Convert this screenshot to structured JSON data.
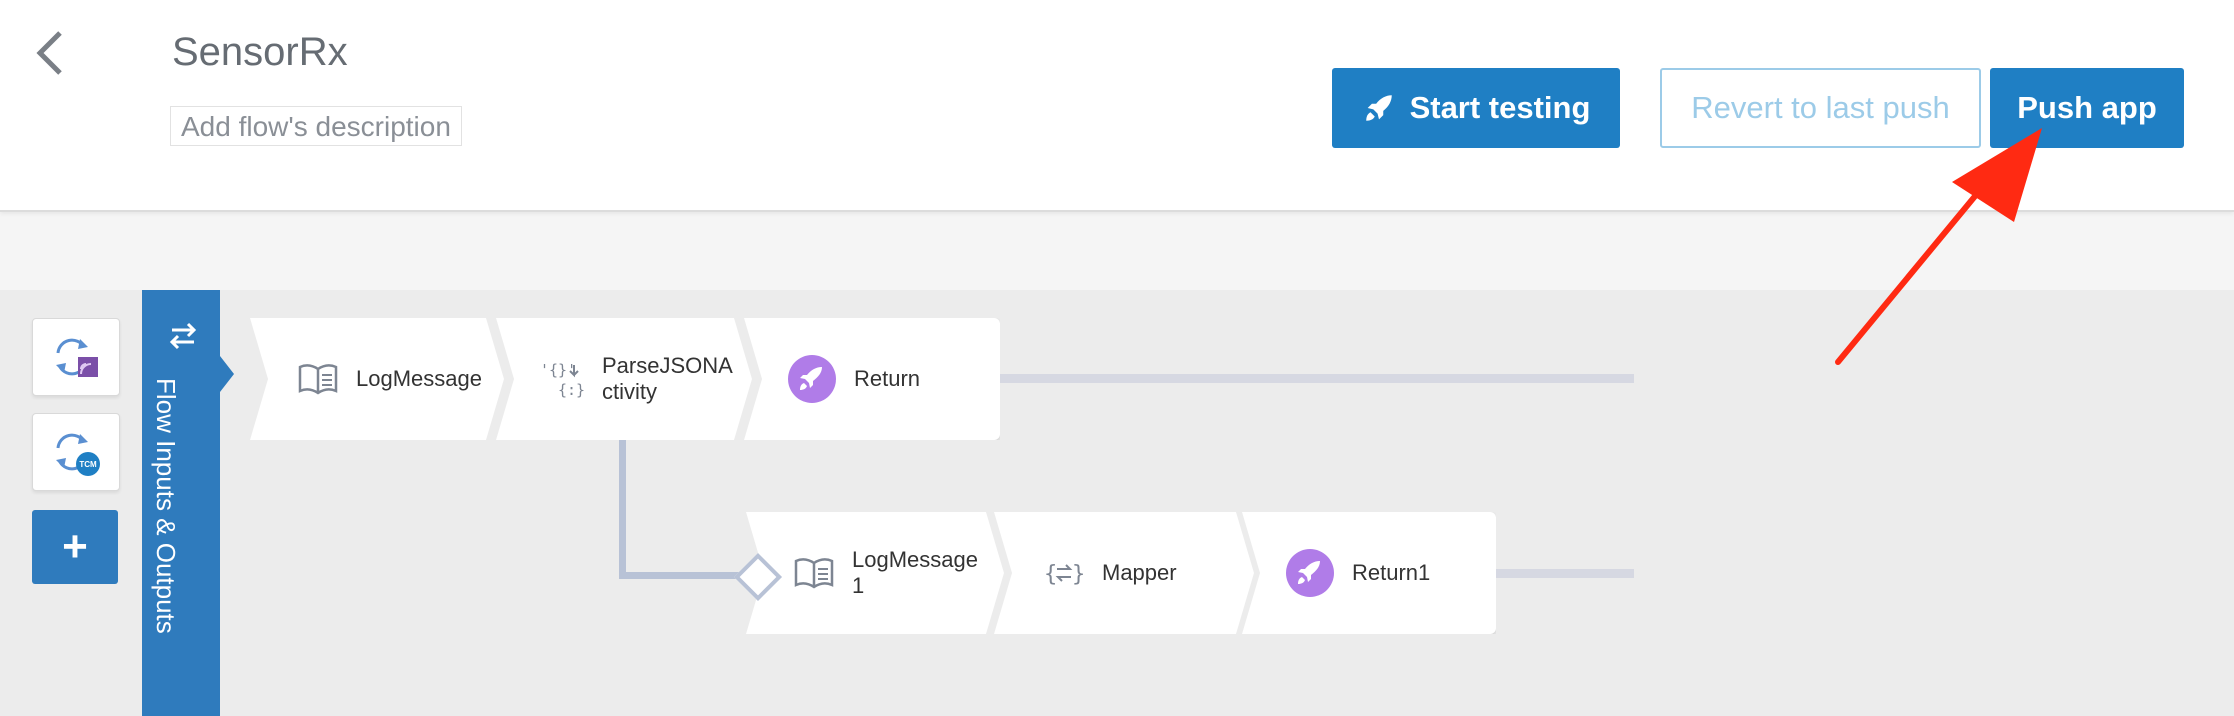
{
  "header": {
    "title": "SensorRx",
    "description_placeholder": "Add flow's description",
    "start_testing_label": "Start testing",
    "revert_label": "Revert to last push",
    "push_label": "Push app"
  },
  "sidebar": {
    "tcm_badge": "TCM",
    "add_label": "+"
  },
  "flow": {
    "io_label": "Flow Inputs & Outputs",
    "main_nodes": [
      {
        "label": "LogMessage",
        "icon": "book-icon"
      },
      {
        "label": "ParseJSONA\nctivity",
        "icon": "json-icon"
      },
      {
        "label": "Return",
        "icon": "rocket-icon"
      }
    ],
    "branch_nodes": [
      {
        "label": "LogMessage\n1",
        "icon": "book-icon"
      },
      {
        "label": "Mapper",
        "icon": "mapper-icon"
      },
      {
        "label": "Return1",
        "icon": "rocket-icon"
      }
    ]
  },
  "colors": {
    "primary": "#1f7fc4",
    "io_bar": "#2f7bbd",
    "annotation": "#ff2a12",
    "rocket": "#b07ce8"
  }
}
